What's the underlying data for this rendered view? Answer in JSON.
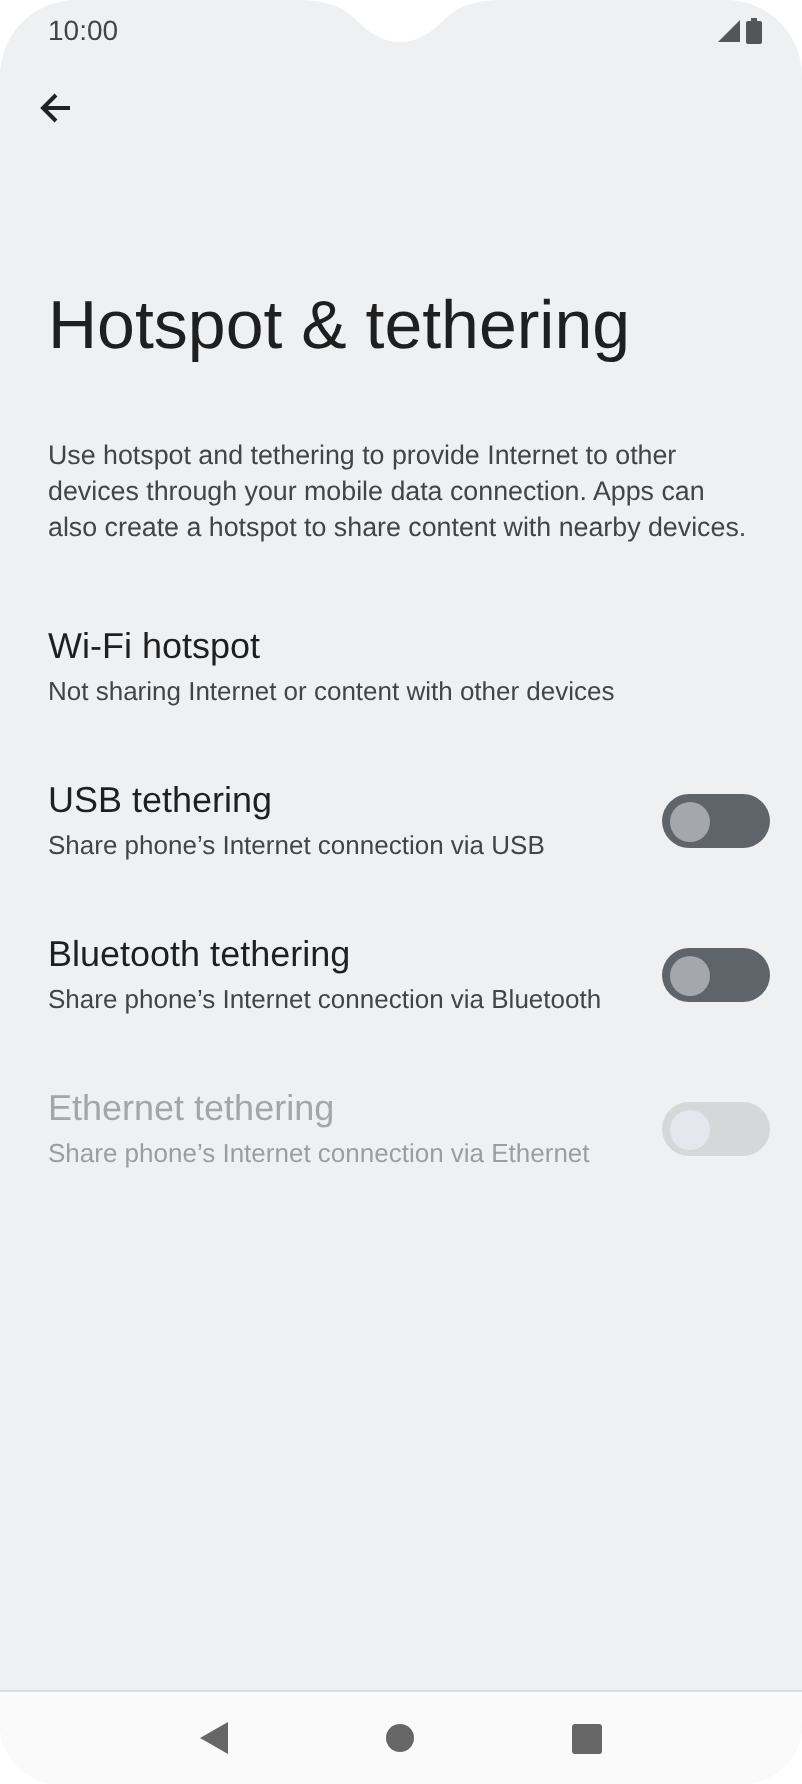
{
  "status_bar": {
    "time": "10:00"
  },
  "title": "Hotspot & tethering",
  "description": "Use hotspot and tethering to provide Internet to other devices through your mobile data connection. Apps can also create a hotspot to share content with nearby devices.",
  "items": [
    {
      "kind": "link",
      "title": "Wi-Fi hotspot",
      "summary": "Not sharing Internet or content with other devices",
      "disabled": false
    },
    {
      "kind": "toggle",
      "title": "USB tethering",
      "summary": "Share phone’s Internet connection via USB",
      "on": false,
      "disabled": false
    },
    {
      "kind": "toggle",
      "title": "Bluetooth tethering",
      "summary": "Share phone’s Internet connection via Bluetooth",
      "on": false,
      "disabled": false
    },
    {
      "kind": "toggle",
      "title": "Ethernet tethering",
      "summary": "Share phone’s Internet connection via Ethernet",
      "on": false,
      "disabled": true
    }
  ]
}
